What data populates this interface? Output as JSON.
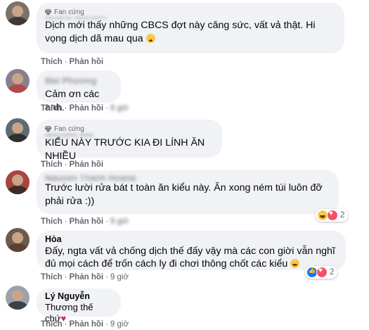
{
  "labels": {
    "fan_badge": "Fan cứng",
    "like": "Thích",
    "reply": "Phản hồi",
    "sep": "·"
  },
  "comments": [
    {
      "author": "Hoàng Nguyễn",
      "author_blurred": true,
      "badge": true,
      "text": "Dịch mới thấy những CBCS đợt này căng sức, vất vả thật. Hi vọng dịch dã mau qua",
      "emoji": "sad-face-emoji",
      "time": ""
    },
    {
      "author": "Mai Phương",
      "author_blurred": true,
      "badge": false,
      "text": "Cảm ơn các anh.",
      "time": "9 giờ"
    },
    {
      "author": "Nguyễn Hải",
      "author_blurred": true,
      "badge": true,
      "text": "KIỂU NÀY TRƯỚC KIA ĐI LÍNH ĂN NHIỀU",
      "time": ""
    },
    {
      "author": "Nguyễn Thanh Hoàng",
      "author_blurred": true,
      "badge": false,
      "text": "Trước lười rửa bát t toàn ăn kiểu này. Ăn xong ném túi luôn đỡ phải rửa :))",
      "time": "9 giờ",
      "reactions": {
        "icons": [
          "haha",
          "love"
        ],
        "count": "2"
      }
    },
    {
      "author": "Hòa",
      "author_blurred": false,
      "badge": false,
      "text": "Đấy, ngta vất vả chống dịch thế đấy vậy mà các con giời vẫn nghĩ đủ mọi cách để trốn cách ly đi chơi thông chốt các kiểu",
      "emoji": "smile-emoji",
      "time": "9 giờ",
      "reactions": {
        "icons": [
          "like",
          "love"
        ],
        "count": "2"
      }
    },
    {
      "author": "Lý Nguyễn",
      "author_blurred": false,
      "badge": false,
      "text": "Thương thế chứ",
      "emoji": "heart-emoji",
      "time": "9 giờ"
    }
  ]
}
